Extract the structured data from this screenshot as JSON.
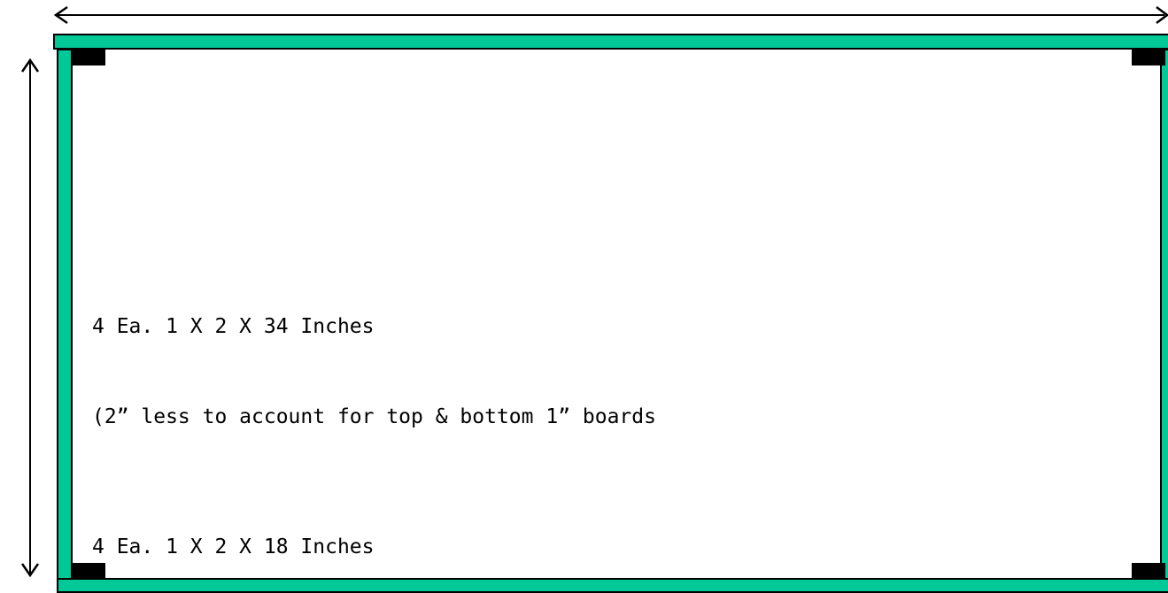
{
  "colors": {
    "board_fill": "#00c896",
    "board_outline": "#000000",
    "corner_block": "#000000",
    "background": "#ffffff",
    "arrow": "#000000"
  },
  "labels": {
    "vertical_boards_line1": "4 Ea. 1 X 2 X 34 Inches",
    "vertical_boards_line2": "(2” less to account for top & bottom 1” boards",
    "horizontal_boards": "4 Ea. 1 X 2 X 18 Inches"
  },
  "icons": {
    "width_arrow": "double-headed-horizontal-arrow",
    "height_arrow": "double-headed-vertical-arrow"
  }
}
